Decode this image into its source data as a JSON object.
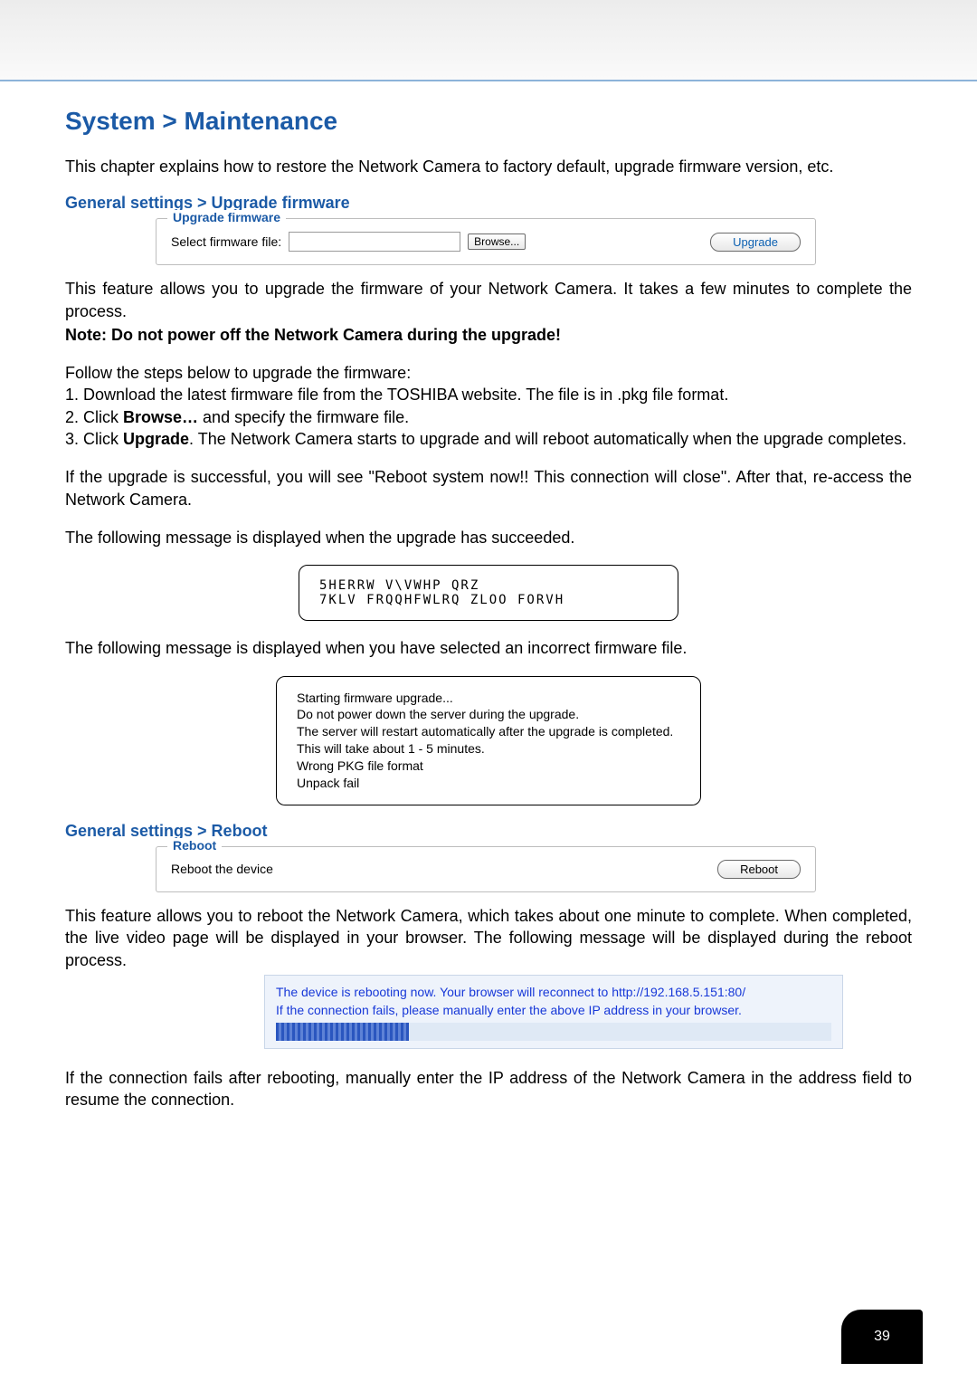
{
  "title": "System > Maintenance",
  "intro": "This chapter explains how to restore the Network Camera to factory default, upgrade firmware version, etc.",
  "upgrade": {
    "heading": "General settings > Upgrade firmware",
    "legend": "Upgrade firmware",
    "select_label": "Select firmware file:",
    "browse_label": "Browse...",
    "upgrade_button": "Upgrade",
    "desc1": "This feature allows you to upgrade the firmware of your Network Camera. It takes a few minutes to complete the process.",
    "note": "Note: Do not power off the Network Camera during the upgrade!",
    "steps_intro": "Follow the steps below to upgrade the firmware:",
    "step1": "1. Download the latest firmware file from the TOSHIBA website. The file is in .pkg file format.",
    "step2a": "2. Click ",
    "step2b": "Browse…",
    "step2c": " and specify the firmware file.",
    "step3a": "3. Click ",
    "step3b": "Upgrade",
    "step3c": ". The Network Camera starts to upgrade and will reboot automatically when the upgrade completes.",
    "success_para": "If the upgrade is successful, you will see \"Reboot system now!! This connection will close\". After that, re-access the Network Camera.",
    "succeed_msg_intro": "The following message is displayed when the upgrade has succeeded.",
    "succeed_box": "5HERRW V\\VWHP QRZ\n7KLV FRQQHFWLRQ ZLOO FORVH",
    "fail_msg_intro": "The following message is displayed when you have selected an incorrect firmware file.",
    "fail_box_l1": "Starting firmware upgrade...",
    "fail_box_l2": "Do not power down the server during the upgrade.",
    "fail_box_l3": "The server will restart automatically after the upgrade is completed.",
    "fail_box_l4": "This will take about 1 - 5 minutes.",
    "fail_box_l5": "Wrong PKG file format",
    "fail_box_l6": "Unpack fail"
  },
  "reboot": {
    "heading": "General settings > Reboot",
    "legend": "Reboot",
    "label": "Reboot the device",
    "button": "Reboot",
    "desc": "This feature allows you to reboot the Network Camera, which takes about one minute to complete. When completed, the live video page will be displayed in your browser. The following message will be displayed during the reboot process.",
    "blue_l1": "The device is rebooting now. Your browser will reconnect to http://192.168.5.151:80/",
    "blue_l2": "If the connection fails, please manually enter the above IP address in your browser.",
    "after": "If the connection fails after rebooting, manually enter the IP address of the Network Camera in the address field to resume the connection."
  },
  "page_number": "39"
}
